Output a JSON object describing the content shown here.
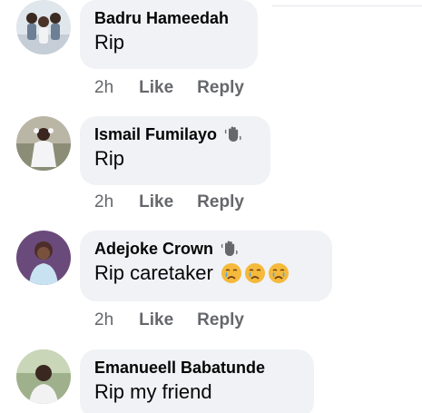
{
  "comments": [
    {
      "author": "Badru Hameedah",
      "text": "Rip",
      "time": "2h",
      "like_label": "Like",
      "reply_label": "Reply",
      "top_fan_badge": false,
      "emojis": []
    },
    {
      "author": "Ismail Fumilayo",
      "text": "Rip",
      "time": "2h",
      "like_label": "Like",
      "reply_label": "Reply",
      "top_fan_badge": true,
      "emojis": []
    },
    {
      "author": "Adejoke Crown",
      "text": "Rip caretaker",
      "time": "2h",
      "like_label": "Like",
      "reply_label": "Reply",
      "top_fan_badge": true,
      "emojis": [
        "crying-face-icon",
        "crying-face-icon",
        "crying-face-icon"
      ]
    },
    {
      "author": "Emanueell Babatunde",
      "text": "Rip my friend",
      "top_fan_badge": false,
      "emojis": []
    }
  ],
  "colors": {
    "bubble": "#f0f2f5",
    "name": "#050505",
    "meta": "#65676b",
    "emoji_face": "#f5b93b",
    "tear": "#5aa7e6"
  }
}
